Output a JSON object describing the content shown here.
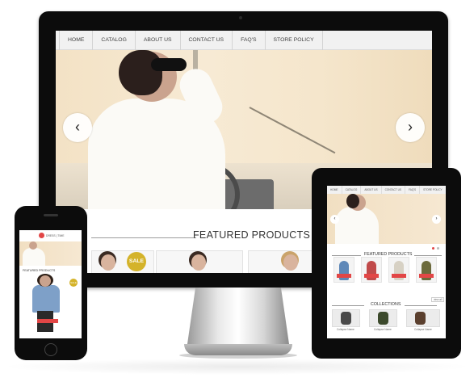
{
  "desktop": {
    "nav": [
      "HOME",
      "CATALOG",
      "ABOUT US",
      "CONTACT US",
      "FAQ'S",
      "STORE POLICY"
    ],
    "hero": {
      "prev_arrow": "‹",
      "next_arrow": "›"
    },
    "featured_title": "FEATURED PRODUCTS",
    "sale_badge": "SALE"
  },
  "tablet": {
    "nav": [
      "HOME",
      "CATALOG",
      "ABOUT US",
      "CONTACT US",
      "FAQ'S",
      "STORE POLICY"
    ],
    "prev_arrow": "‹",
    "next_arrow": "›",
    "featured_title": "FEATURED PRODUCTS",
    "collections_title": "COLLECTIONS",
    "collection_captions": [
      "Collapse Name",
      "Collapse Name",
      "Collapse Name"
    ],
    "view_all": "view all"
  },
  "phone": {
    "logo_text": "DRESS | TIME",
    "featured_title": "FEATURED PRODUCTS",
    "sale_badge": "SALE"
  },
  "colors": {
    "accent_red": "#e24646",
    "sale_gold": "#d4b32a",
    "device_black": "#0c0c0c"
  }
}
